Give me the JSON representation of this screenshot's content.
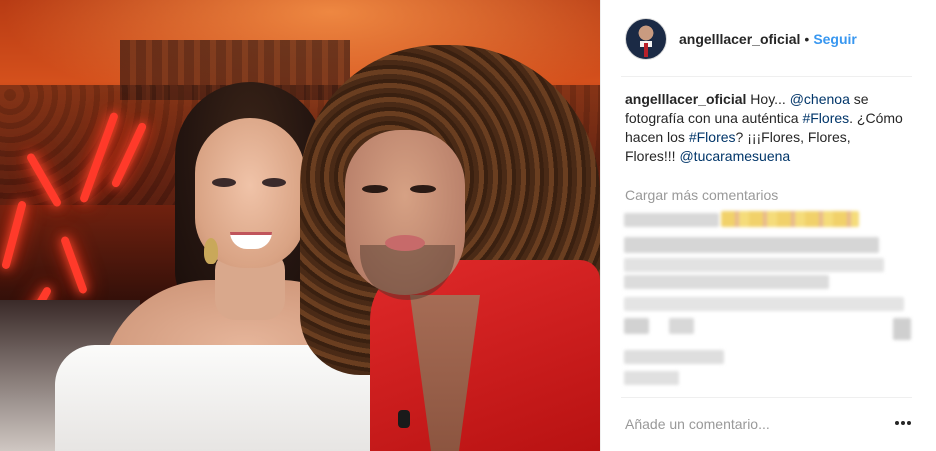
{
  "post": {
    "header": {
      "username": "angelllacer_oficial",
      "separator": "•",
      "follow_label": "Seguir"
    },
    "caption": {
      "username": "angelllacer_oficial",
      "part1": " Hoy... ",
      "mention1": "@chenoa",
      "part2": " se fotografía con una auténtica ",
      "hashtag1": "#Flores",
      "part3": ". ¿Cómo hacen los ",
      "hashtag2": "#Flores",
      "part4": "? ¡¡¡Flores, Flores, Flores!!! ",
      "mention2": "@tucaramesuena"
    },
    "load_more_label": "Cargar más comentarios",
    "comment_placeholder": "Añade un comentario...",
    "colors": {
      "link": "#003569",
      "follow": "#3897f0",
      "secondary_text": "#999999"
    }
  }
}
